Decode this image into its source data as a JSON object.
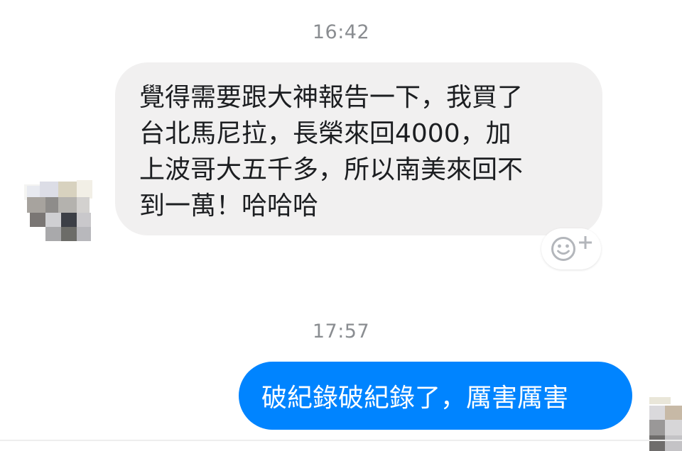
{
  "conversation": {
    "timestamps": [
      "16:42",
      "17:57"
    ],
    "incoming_message": {
      "text": "覺得需要跟大神報告一下，我買了\n台北馬尼拉，長榮來回4000，加\n上波哥大五千多，所以南美來回不\n到一萬！哈哈哈",
      "reaction_icon": "add-reaction-icon"
    },
    "outgoing_message": {
      "text": "破紀錄破紀錄了，厲害厲害"
    }
  },
  "colors": {
    "incoming_bubble": "#f1f0f0",
    "outgoing_bubble": "#0084ff",
    "timestamp": "#8a8d91",
    "background": "#ffffff"
  }
}
